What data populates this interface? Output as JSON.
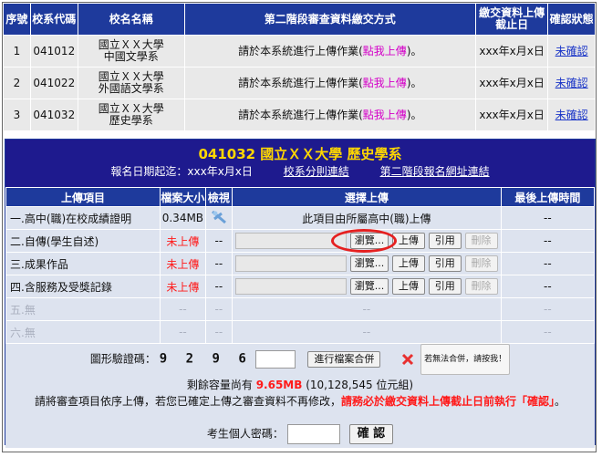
{
  "top_table": {
    "headers": [
      "序號",
      "校系代碼",
      "校名名稱",
      "第二階段審查資料繳交方式",
      "繳交資料上傳截止日",
      "確認狀態"
    ],
    "rows": [
      {
        "no": "1",
        "code": "041012",
        "school": "國立ＸＸ大學",
        "dept": "中國文學系",
        "method_prefix": "請於本系統進行上傳作業(",
        "method_link": "點我上傳",
        "method_suffix": ")。",
        "deadline": "xxx年x月x日",
        "status": "未確認"
      },
      {
        "no": "2",
        "code": "041022",
        "school": "國立ＸＸ大學",
        "dept": "外國語文學系",
        "method_prefix": "請於本系統進行上傳作業(",
        "method_link": "點我上傳",
        "method_suffix": ")。",
        "deadline": "xxx年x月x日",
        "status": "未確認"
      },
      {
        "no": "3",
        "code": "041032",
        "school": "國立ＸＸ大學",
        "dept": "歷史學系",
        "method_prefix": "請於本系統進行上傳作業(",
        "method_link": "點我上傳",
        "method_suffix": ")。",
        "deadline": "xxx年x月x日",
        "status": "未確認"
      }
    ]
  },
  "panel": {
    "title": "041032 國立ＸＸ大學 歷史學系",
    "date_label": "報名日期起迄：xxx年x月x日",
    "link1": "校系分則連結",
    "link2": "第二階段報名網址連結",
    "headers": [
      "上傳項目",
      "檔案大小",
      "檢視",
      "選擇上傳",
      "最後上傳時間"
    ],
    "rows": [
      {
        "item": "一.高中(職)在校成績證明",
        "size": "0.34MB",
        "view": "icon",
        "select_text": "此項目由所屬高中(職)上傳",
        "last": "--"
      },
      {
        "item": "二.自傳(學生自述)",
        "size": "未上傳",
        "view": "--",
        "browse": "瀏覽...",
        "upload": "上傳",
        "cite": "引用",
        "delete": "刪除",
        "last": "--"
      },
      {
        "item": "三.成果作品",
        "size": "未上傳",
        "view": "--",
        "browse": "瀏覽...",
        "upload": "上傳",
        "cite": "引用",
        "delete": "刪除",
        "last": "--"
      },
      {
        "item": "四.含服務及受獎記錄",
        "size": "未上傳",
        "view": "--",
        "browse": "瀏覽...",
        "upload": "上傳",
        "cite": "引用",
        "delete": "刪除",
        "last": "--"
      },
      {
        "item": "五.無",
        "size": "--",
        "view": "--",
        "select_text": "--",
        "last": "--"
      },
      {
        "item": "六.無",
        "size": "--",
        "view": "--",
        "select_text": "--",
        "last": "--"
      }
    ],
    "captcha_label": "圖形驗證碼：",
    "captcha_code": "9 2 9 6",
    "merge_button": "進行檔案合併",
    "merge_fail_label": "若無法合併，請按我！",
    "remaining_prefix": "剩餘容量尚有 ",
    "remaining_value": "9.65MB",
    "remaining_suffix": " (10,128,545 位元組)",
    "note_prefix": "請將審查項目依序上傳，若您已確定上傳之審查資料不再修改，",
    "note_red": "請務必於繳交資料上傳截止日前執行「確認」",
    "note_suffix": "。",
    "password_label": "考生個人密碼：",
    "confirm_button": "確 認"
  }
}
